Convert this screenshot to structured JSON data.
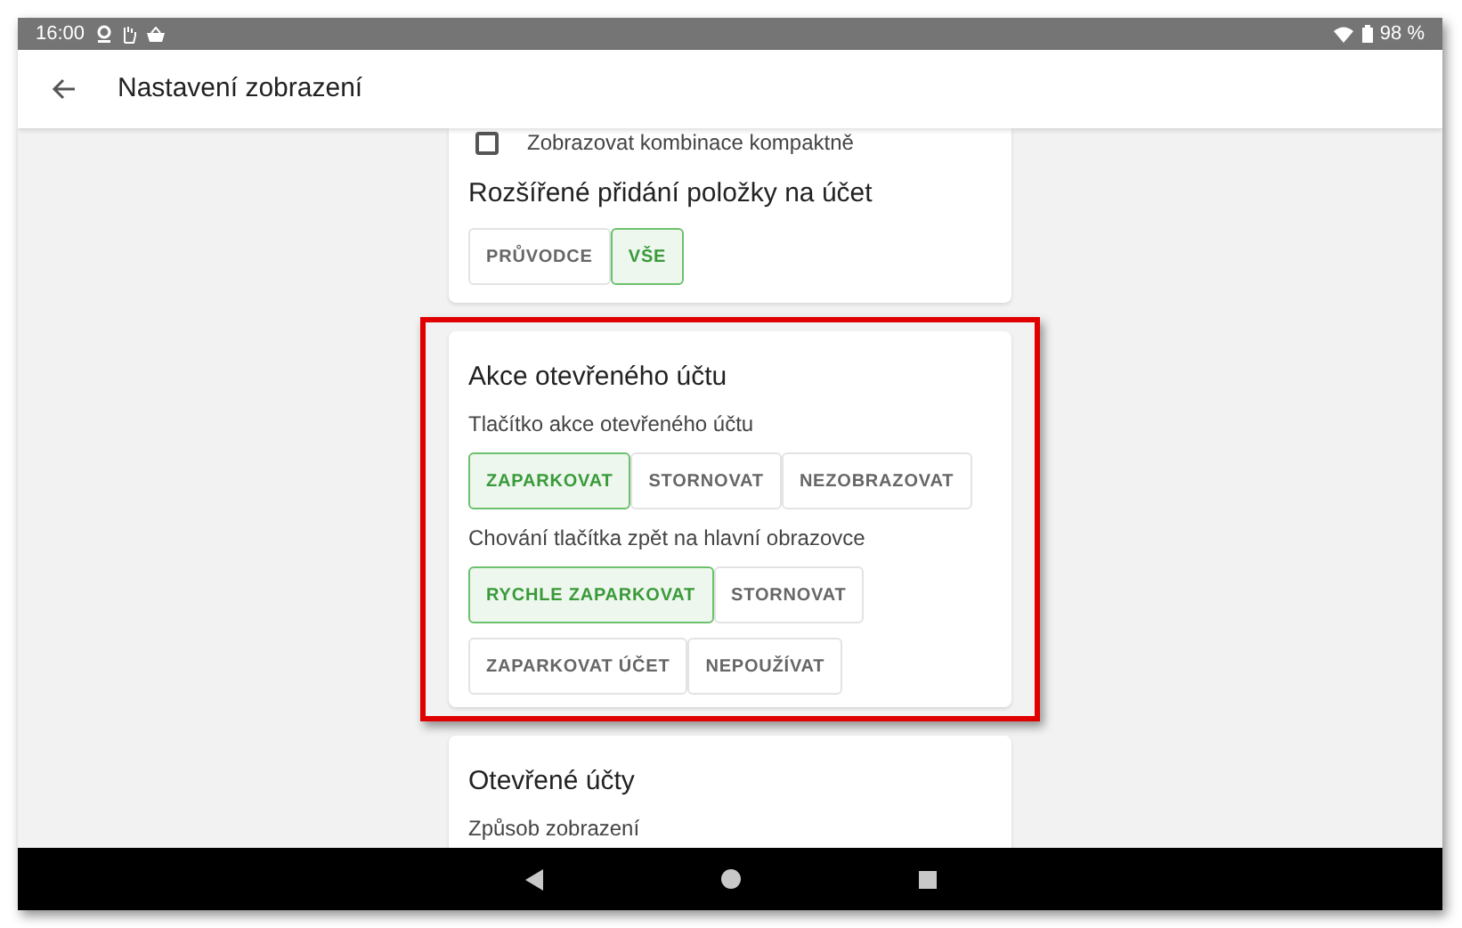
{
  "status_bar": {
    "time": "16:00",
    "battery": "98 %"
  },
  "app_bar": {
    "title": "Nastavení zobrazení"
  },
  "cards": [
    {
      "highlighted": false,
      "items": [
        {
          "kind": "checkbox",
          "label": "Zobrazovat kombinace kompaktně",
          "checked": false
        },
        {
          "kind": "heading",
          "text": "Rozšířené přidání položky na účet"
        },
        {
          "kind": "segmented",
          "options": [
            {
              "label": "PRŮVODCE",
              "selected": false
            },
            {
              "label": "VŠE",
              "selected": true
            }
          ]
        }
      ]
    },
    {
      "highlighted": true,
      "items": [
        {
          "kind": "heading",
          "text": "Akce otevřeného účtu"
        },
        {
          "kind": "label",
          "text": "Tlačítko akce otevřeného účtu"
        },
        {
          "kind": "segmented",
          "options": [
            {
              "label": "ZAPARKOVAT",
              "selected": true
            },
            {
              "label": "STORNOVAT",
              "selected": false
            },
            {
              "label": "NEZOBRAZOVAT",
              "selected": false
            }
          ]
        },
        {
          "kind": "label",
          "text": "Chování tlačítka zpět na hlavní obrazovce"
        },
        {
          "kind": "segmented",
          "options": [
            {
              "label": "RYCHLE ZAPARKOVAT",
              "selected": true
            },
            {
              "label": "STORNOVAT",
              "selected": false
            },
            {
              "label": "ZAPARKOVAT ÚČET",
              "selected": false
            },
            {
              "label": "NEPOUŽÍVAT",
              "selected": false
            }
          ]
        }
      ]
    },
    {
      "highlighted": false,
      "items": [
        {
          "kind": "heading",
          "text": "Otevřené účty"
        },
        {
          "kind": "label",
          "text": "Způsob zobrazení"
        }
      ]
    }
  ]
}
